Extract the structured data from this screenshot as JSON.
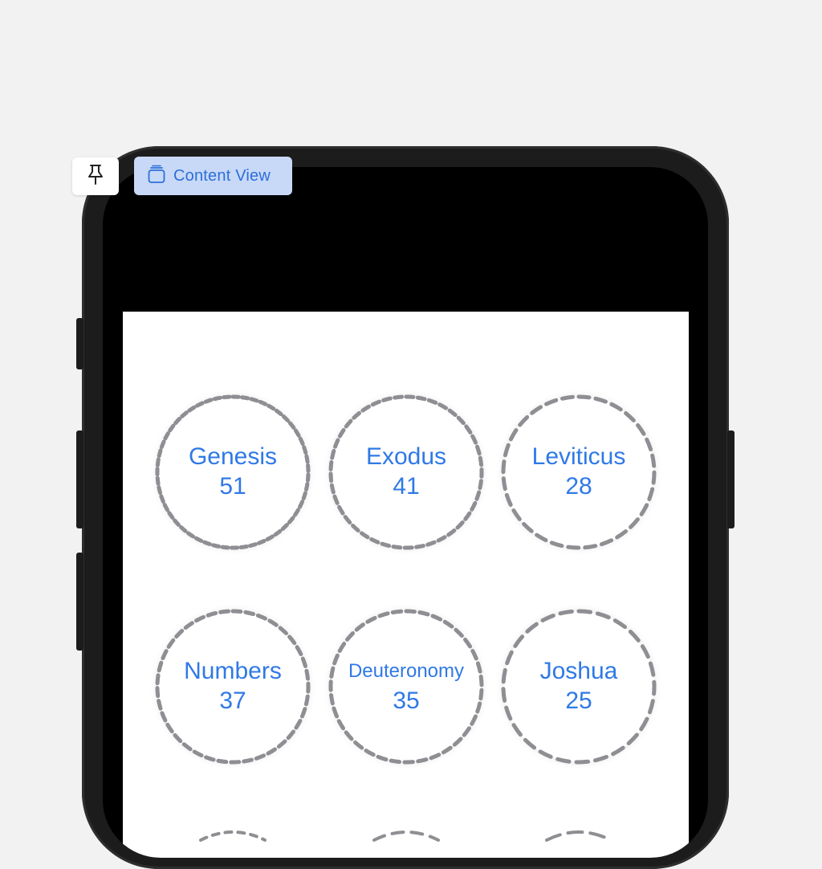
{
  "toolbar": {
    "pin_icon": "pin-icon",
    "chip_icon": "stack-icon",
    "chip_label": "Content View"
  },
  "colors": {
    "accent": "#2f79e6",
    "ring": "#8e8e93",
    "chip_bg": "#c8d9f7"
  },
  "books": [
    {
      "name": "Genesis",
      "chapters": "51"
    },
    {
      "name": "Exodus",
      "chapters": "41"
    },
    {
      "name": "Leviticus",
      "chapters": "28"
    },
    {
      "name": "Numbers",
      "chapters": "37"
    },
    {
      "name": "Deuteronomy",
      "chapters": "35"
    },
    {
      "name": "Joshua",
      "chapters": "25"
    }
  ]
}
